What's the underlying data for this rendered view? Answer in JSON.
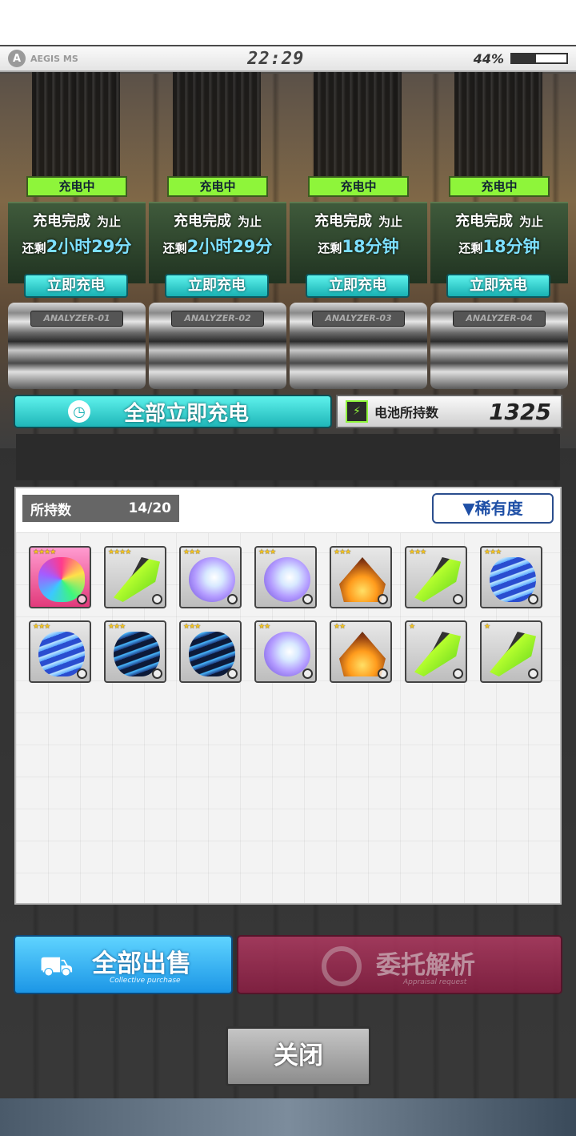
{
  "statusbar": {
    "brand": "AEGIS MS",
    "time": "22:29",
    "battery": "44%",
    "battery_level": 0.44
  },
  "chargers": [
    {
      "status": "充电中",
      "line1": "充电完成",
      "line1_suffix": "为止",
      "remain_prefix": "还剩",
      "remain": "2小时29分",
      "button": "立即充电",
      "machine": "ANALYZER-01"
    },
    {
      "status": "充电中",
      "line1": "充电完成",
      "line1_suffix": "为止",
      "remain_prefix": "还剩",
      "remain": "2小时29分",
      "button": "立即充电",
      "machine": "ANALYZER-02"
    },
    {
      "status": "充电中",
      "line1": "充电完成",
      "line1_suffix": "为止",
      "remain_prefix": "还剩",
      "remain": "18分钟",
      "button": "立即充电",
      "machine": "ANALYZER-03"
    },
    {
      "status": "充电中",
      "line1": "充电完成",
      "line1_suffix": "为止",
      "remain_prefix": "还剩",
      "remain": "18分钟",
      "button": "立即充电",
      "machine": "ANALYZER-04"
    }
  ],
  "all_charge_label": "全部立即充电",
  "battery_stock": {
    "label": "电池所持数",
    "value": "1325"
  },
  "inventory": {
    "owned_label": "所持数",
    "owned_value": "14/20",
    "sort_label": "▼稀有度",
    "items": [
      {
        "icon": "rainbow-shell-icon",
        "stars": "★★★★"
      },
      {
        "icon": "green-conch-icon",
        "stars": "★★★★"
      },
      {
        "icon": "nautilus-shell-icon",
        "stars": "★★★"
      },
      {
        "icon": "nautilus-shell-icon",
        "stars": "★★★"
      },
      {
        "icon": "orange-volute-icon",
        "stars": "★★★"
      },
      {
        "icon": "green-conch-icon",
        "stars": "★★★"
      },
      {
        "icon": "blue-clam-icon",
        "stars": "★★★"
      },
      {
        "icon": "blue-clam-icon",
        "stars": "★★★"
      },
      {
        "icon": "dark-clam-icon",
        "stars": "★★★"
      },
      {
        "icon": "dark-clam-icon",
        "stars": "★★★"
      },
      {
        "icon": "nautilus-shell-icon",
        "stars": "★★"
      },
      {
        "icon": "orange-volute-icon",
        "stars": "★★"
      },
      {
        "icon": "green-conch-icon",
        "stars": "★"
      },
      {
        "icon": "green-conch-icon",
        "stars": "★"
      }
    ]
  },
  "sell_all": {
    "label": "全部出售",
    "sub": "Collective purchase"
  },
  "analyze": {
    "label": "委托解析",
    "sub": "Appraisal request"
  },
  "close_label": "关闭",
  "colors": {
    "accent_cyan": "#1fb6b8",
    "status_green": "#8ef53a",
    "sell_blue": "#1c96e6",
    "analyze_red": "#8a1d42"
  }
}
